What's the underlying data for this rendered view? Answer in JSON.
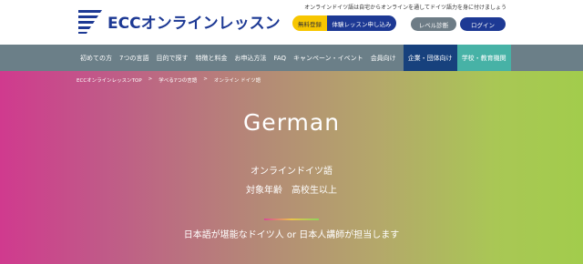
{
  "header": {
    "tagline": "オンラインドイツ語は自宅からオンラインを通してドイツ語力を身に付けましょう",
    "logo_text": "ECCオンラインレッスン",
    "register_free": "無料登録",
    "register_trial": "体験レッスン申し込み",
    "level_check": "レベル診断",
    "login": "ログイン"
  },
  "nav": {
    "items": [
      "初めての方",
      "7つの言語",
      "目的で探す",
      "特徴と料金",
      "お申込方法",
      "FAQ",
      "キャンペーン・イベント",
      "会員向け"
    ],
    "corporate": "企業・団体向け",
    "school": "学校・教育機関"
  },
  "breadcrumb": [
    "ECCオンラインレッスンTOP",
    ">",
    "学べる7つの言語",
    ">",
    "オンライン ドイツ語"
  ],
  "hero": {
    "title": "German",
    "subtitle": "オンラインドイツ語",
    "age": "対象年齢　高校生以上",
    "note": "日本語が堪能なドイツ人 or 日本人講師が担当します"
  },
  "colors": {
    "brand_navy": "#1d3994",
    "nav_gray": "#6b7f88",
    "corp_blue": "#17417d",
    "school_teal": "#47b2a6",
    "free_yellow": "#f7c600"
  }
}
